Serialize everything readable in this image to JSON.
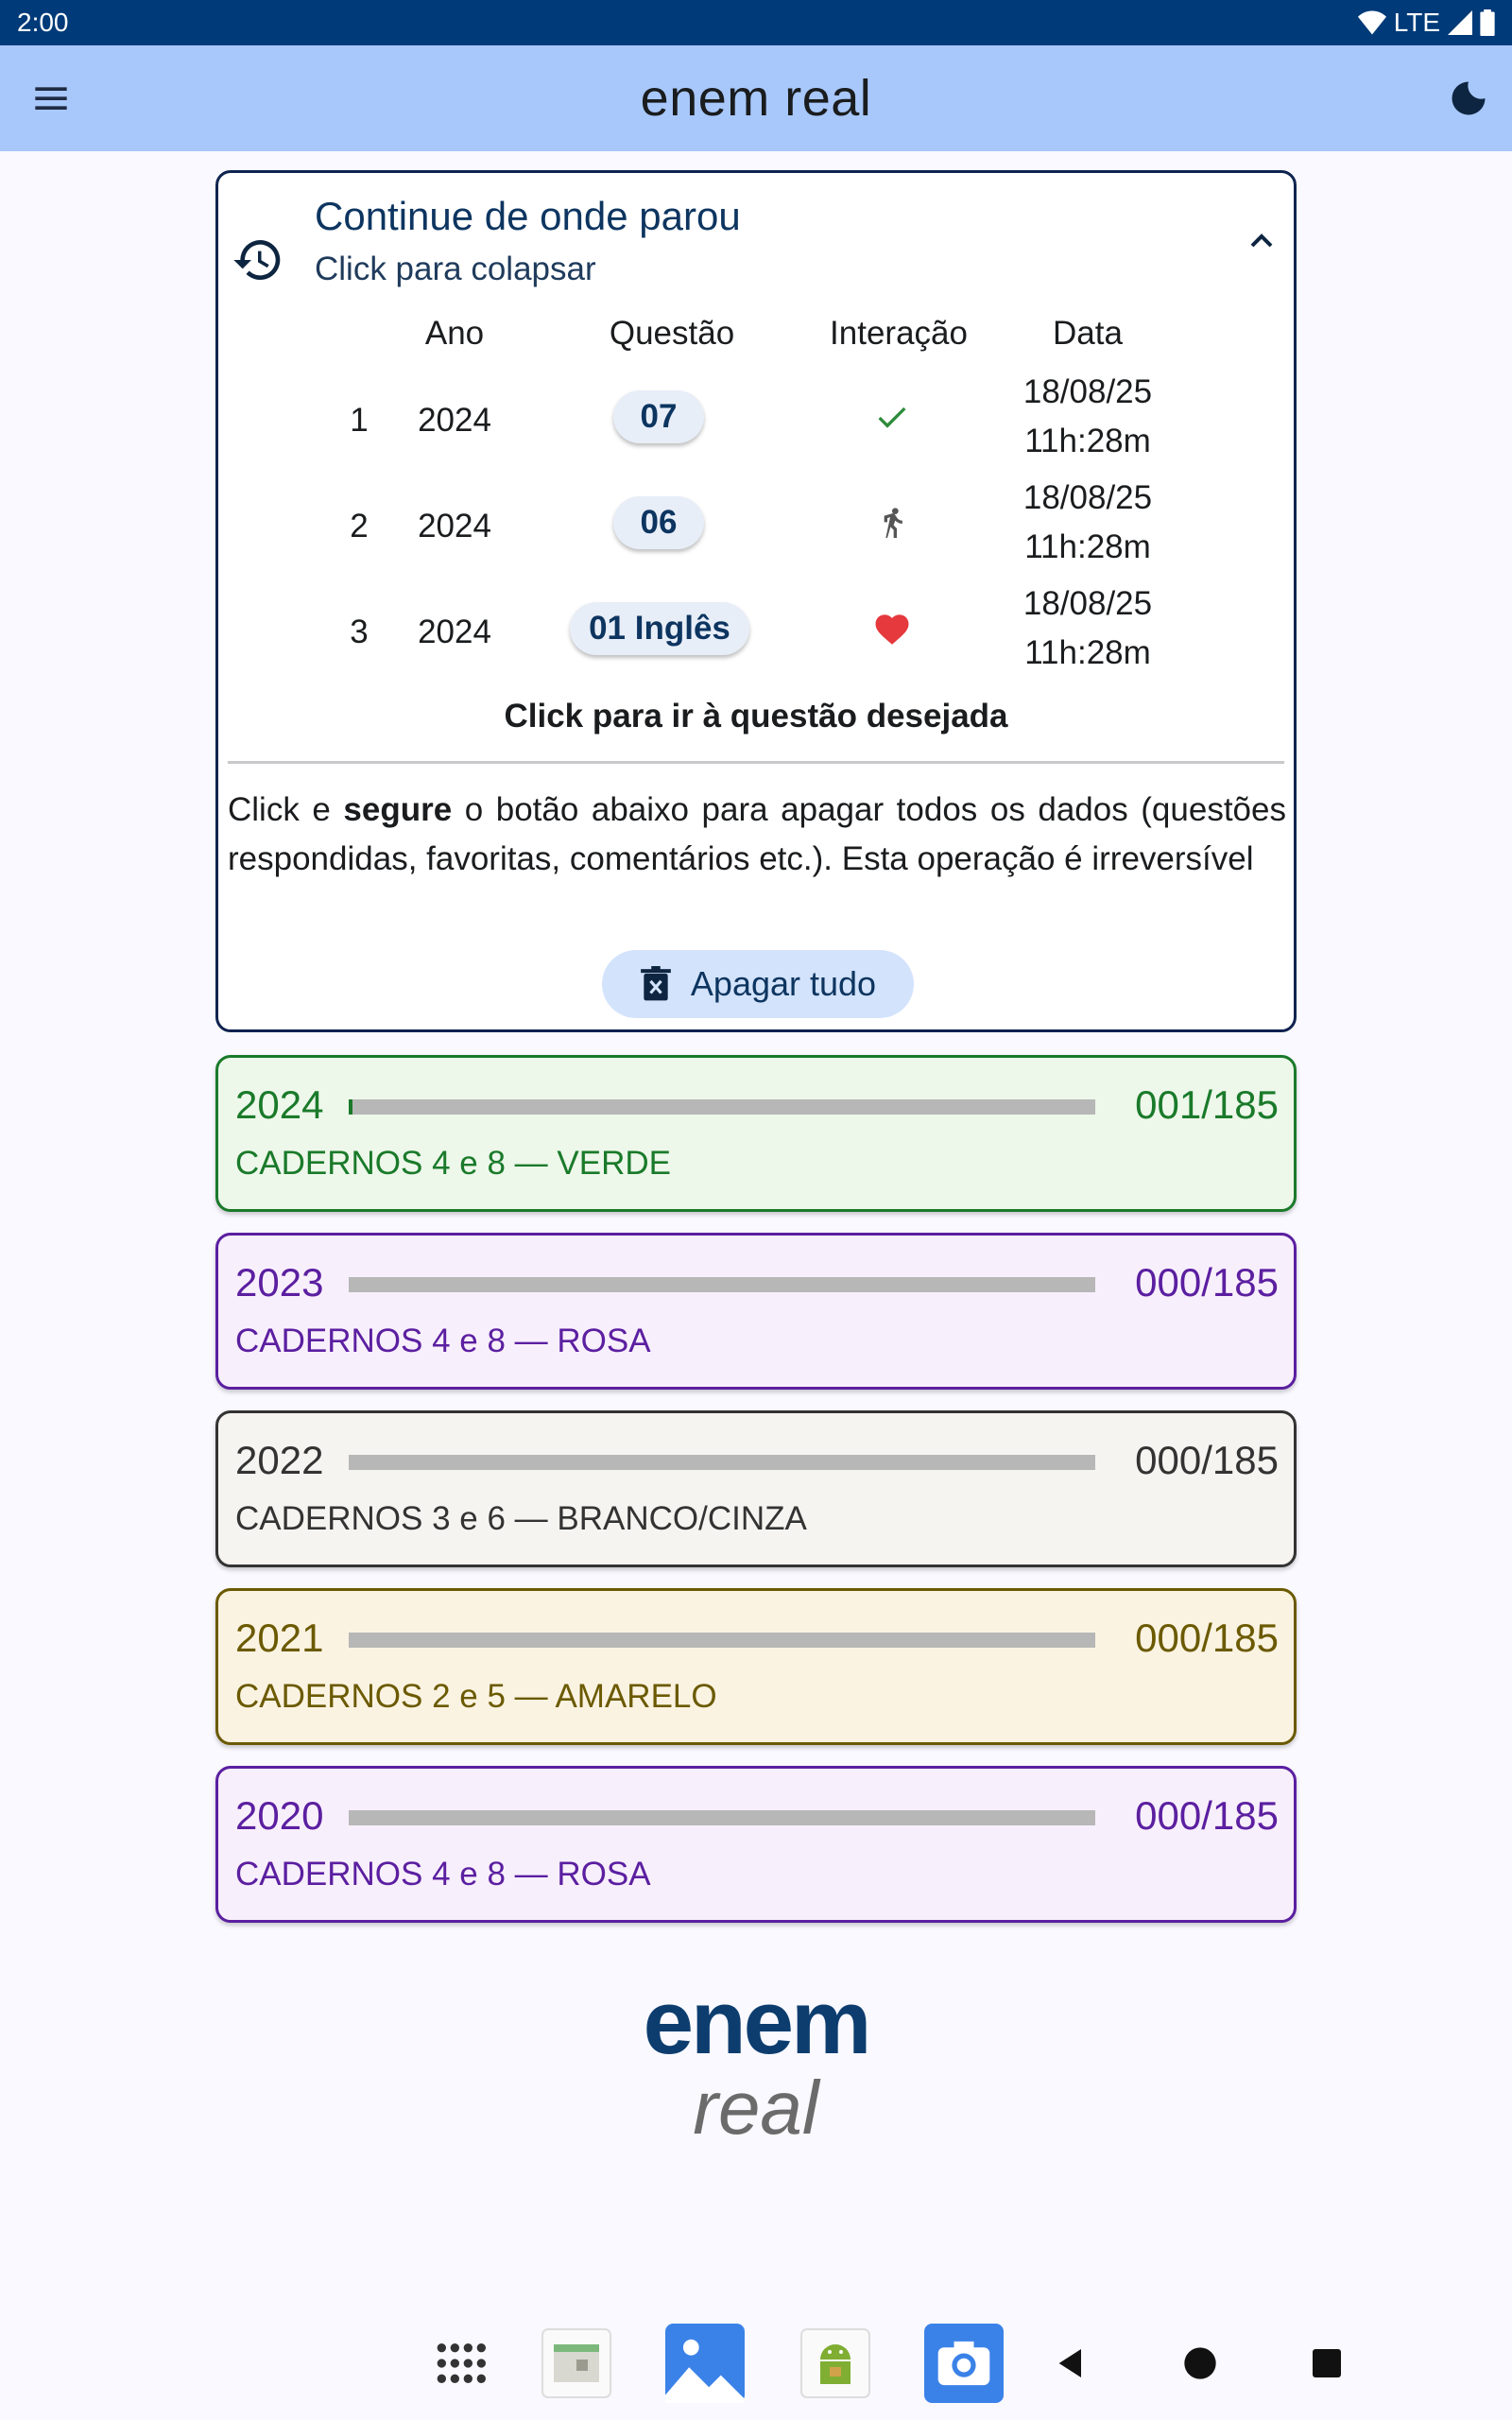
{
  "status_bar": {
    "time": "2:00",
    "network": "LTE"
  },
  "app_bar": {
    "title": "enem real"
  },
  "resume": {
    "title": "Continue de onde parou",
    "subtitle": "Click para colapsar",
    "columns": [
      "Ano",
      "Questão",
      "Interação",
      "Data"
    ],
    "rows": [
      {
        "idx": "1",
        "year": "2024",
        "question": "07",
        "interaction": "check-icon",
        "date": "18/08/25",
        "time": "11h:28m"
      },
      {
        "idx": "2",
        "year": "2024",
        "question": "06",
        "interaction": "run-icon",
        "date": "18/08/25",
        "time": "11h:28m"
      },
      {
        "idx": "3",
        "year": "2024",
        "question": "01 Inglês",
        "interaction": "heart-icon",
        "date": "18/08/25",
        "time": "11h:28m"
      }
    ],
    "hint": "Click para ir à questão desejada",
    "warning_pre": "Click e ",
    "warning_bold": "segure",
    "warning_post": " o botão abaixo para apagar todos os dados (questões respondidas, favoritas, comentários etc.). Esta operação é irreversível",
    "delete_label": "Apagar tudo"
  },
  "years": [
    {
      "year": "2024",
      "count": "001/185",
      "progress": 0.0054,
      "caderno": "CADERNOS 4 e 8 — VERDE",
      "color": "#1a7a2a",
      "bg": "#edf7ea"
    },
    {
      "year": "2023",
      "count": "000/185",
      "progress": 0,
      "caderno": "CADERNOS 4 e 8 — ROSA",
      "color": "#5b1fa0",
      "bg": "#f8effc"
    },
    {
      "year": "2022",
      "count": "000/185",
      "progress": 0,
      "caderno": "CADERNOS 3 e 6 — BRANCO/CINZA",
      "color": "#333333",
      "bg": "#f5f4f0"
    },
    {
      "year": "2021",
      "count": "000/185",
      "progress": 0,
      "caderno": "CADERNOS 2 e 5 — AMARELO",
      "color": "#6b5a00",
      "bg": "#fbf3e2"
    },
    {
      "year": "2020",
      "count": "000/185",
      "progress": 0,
      "caderno": "CADERNOS 4 e 8 — ROSA",
      "color": "#5b1fa0",
      "bg": "#f8effc"
    }
  ],
  "logo": {
    "line1": "enem",
    "line2": "real"
  },
  "colors": {
    "accent": "#a8c8fb",
    "status_bar": "#003a78",
    "card_border": "#0f2350"
  }
}
